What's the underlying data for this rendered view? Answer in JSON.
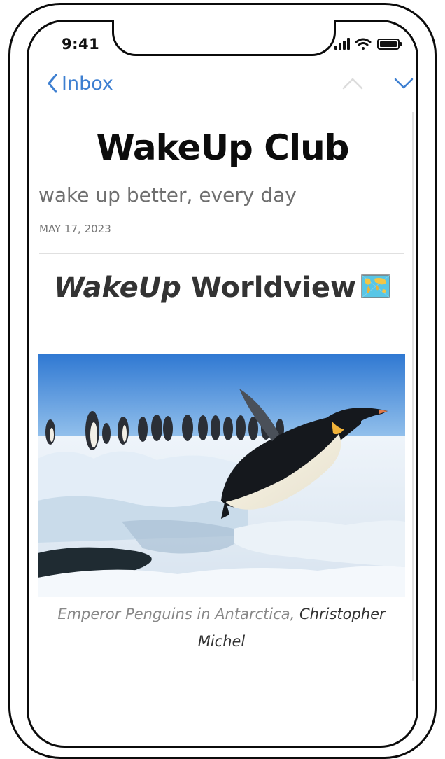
{
  "status_bar": {
    "time": "9:41"
  },
  "nav": {
    "back_label": "Inbox"
  },
  "email": {
    "brand_title": "WakeUp Club",
    "tagline": "wake up better, every day",
    "date": "MAY 17, 2023",
    "section_title_italic": "WakeUp",
    "section_title_rest": "Worldview",
    "section_emoji": "world-map-icon",
    "image_caption": "Emperor Penguins in Antarctica,",
    "image_credit": "Christopher Michel"
  },
  "colors": {
    "accent": "#3d7fd1",
    "text": "#0c0c0c",
    "muted": "#6f6f6f"
  }
}
